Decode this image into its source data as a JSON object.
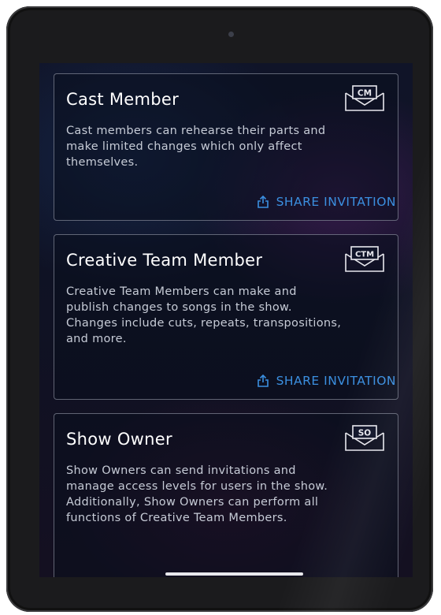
{
  "cards": [
    {
      "title": "Cast Member",
      "badge": "CM",
      "description": "Cast members can rehearse their parts and make limited changes which only affect themselves.",
      "action": "SHARE INVITATION",
      "icon": "envelope-icon"
    },
    {
      "title": "Creative Team Member",
      "badge": "CTM",
      "description": "Creative Team Members can make and publish changes to songs in the show. Changes include cuts, repeats, transpositions, and more.",
      "action": "SHARE INVITATION",
      "icon": "envelope-icon"
    },
    {
      "title": "Show Owner",
      "badge": "SO",
      "description": "Show Owners can send invitations and manage access levels for users in the show. Additionally, Show Owners can perform all functions of Creative Team Members.",
      "icon": "envelope-icon"
    }
  ],
  "colors": {
    "accent": "#3b8fe0",
    "title": "#ffffff",
    "body_text": "#c6cbd6",
    "card_border": "#c8cddc"
  }
}
